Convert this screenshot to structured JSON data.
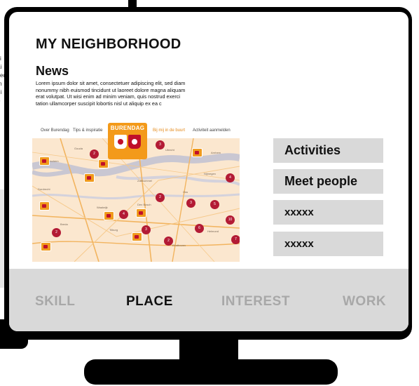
{
  "page": {
    "title": "MY NEIGHBORHOOD"
  },
  "news": {
    "heading": "News",
    "body": "Lorem ipsum dolor sit amet, consectetuer adipiscing elit, sed diam nonummy nibh euismod tincidunt ut laoreet dolore magna aliquam erat volutpat. Ut wisi enim ad minim veniam, quis nostrud exerci tation ullamcorper suscipit lobortis nisl ut aliquip ex ea c"
  },
  "website": {
    "nav": [
      "Over Burendag",
      "Tips & inspiratie",
      "Bij mij in de buurt",
      "Activiteit aanmelden"
    ],
    "logo_text": "BURENDAG",
    "map_labels": [
      "Gorinchem",
      "Dordrecht",
      "Gouda",
      "Utrecht",
      "Breda",
      "Tilburg",
      "Den Bosch",
      "Zaltbommel",
      "Nijmegen",
      "Arnhem",
      "Oss",
      "Waalwijk",
      "Eindhoven",
      "Helmond"
    ],
    "pin_numbers": [
      "2",
      "3",
      "4",
      "5",
      "2",
      "3",
      "2",
      "4",
      "6",
      "10",
      "7",
      "3",
      "2"
    ],
    "accent_color": "#f39a1a",
    "pin_color": "#b31b35"
  },
  "menu": {
    "items": [
      "Activities",
      "Meet people",
      "xxxxx",
      "xxxxx"
    ]
  },
  "tabs": {
    "items": [
      {
        "label": "SKILL",
        "active": false
      },
      {
        "label": "PLACE",
        "active": true
      },
      {
        "label": "INTEREST",
        "active": false
      },
      {
        "label": "WORK",
        "active": false
      }
    ]
  },
  "background": {
    "peek_text": [
      "si",
      "ai",
      "sed",
      "m",
      "ni",
      "p"
    ]
  }
}
